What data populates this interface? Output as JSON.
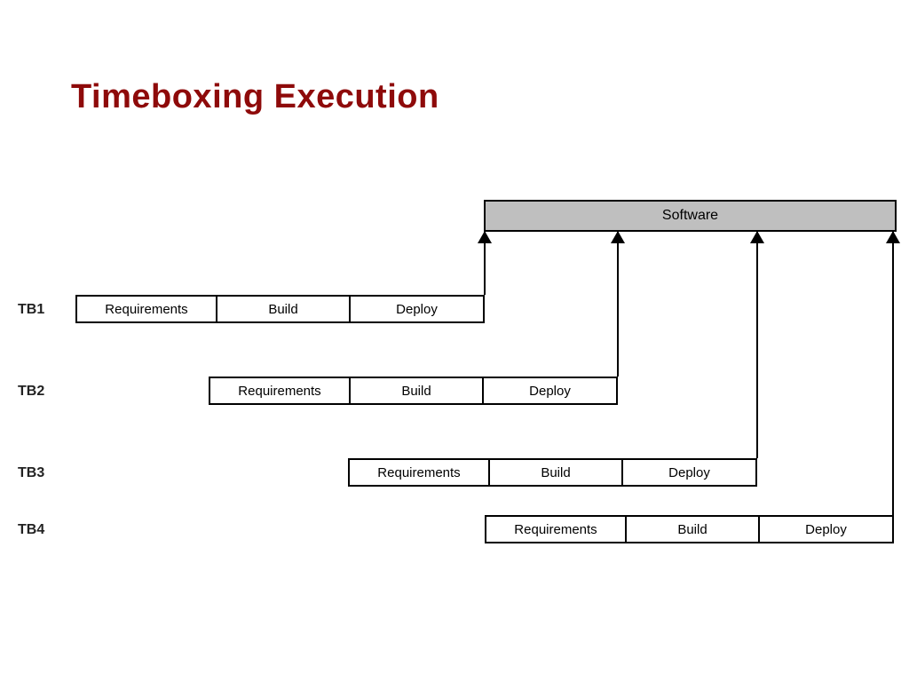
{
  "title": "Timeboxing Execution",
  "software_label": "Software",
  "phases": [
    "Requirements",
    "Build",
    "Deploy"
  ],
  "rows": [
    {
      "label": "TB1"
    },
    {
      "label": "TB2"
    },
    {
      "label": "TB3"
    },
    {
      "label": "TB4"
    }
  ]
}
